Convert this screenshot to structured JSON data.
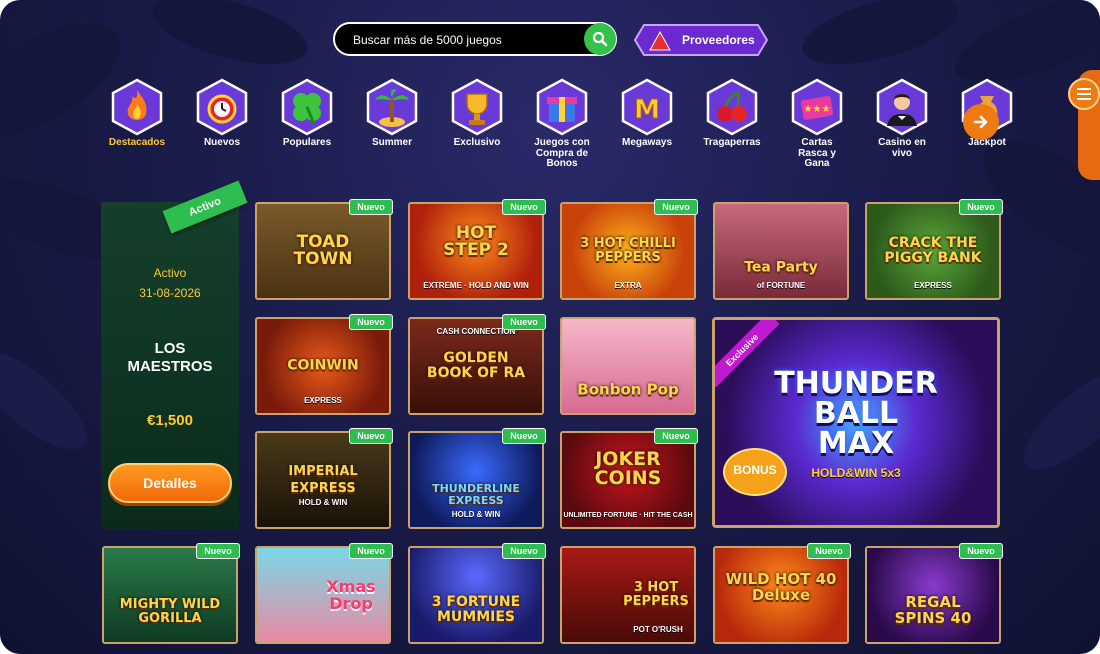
{
  "search": {
    "placeholder": "Buscar más de 5000 juegos",
    "icon": "search-icon"
  },
  "providers_label": "Proveedores",
  "categories": [
    {
      "label": "Destacados",
      "icon": "fire-icon",
      "active": true
    },
    {
      "label": "Nuevos",
      "icon": "alarm-clock-icon"
    },
    {
      "label": "Populares",
      "icon": "clover-icon"
    },
    {
      "label": "Summer",
      "icon": "palm-tree-icon"
    },
    {
      "label": "Exclusivo",
      "icon": "trophy-icon"
    },
    {
      "label": "Juegos con\nCompra de\nBonos",
      "icon": "gift-icon"
    },
    {
      "label": "Megaways",
      "icon": "m-letter-icon"
    },
    {
      "label": "Tragaperras",
      "icon": "cherries-icon"
    },
    {
      "label": "Cartas\nRasca y\nGana",
      "icon": "scratch-card-icon"
    },
    {
      "label": "Casino en\nvivo",
      "icon": "dealer-icon"
    },
    {
      "label": "Jackpot",
      "icon": "money-bag-icon"
    }
  ],
  "promo": {
    "ribbon": "Activo",
    "status": "Activo",
    "date": "31-08-2026",
    "title": "LOS\nMAESTROS",
    "amount": "€1,500",
    "button": "Detalles"
  },
  "badge_new": "Nuevo",
  "games": [
    {
      "name": "TOAD\nTOWN",
      "sub": "",
      "color": "#6b4a22"
    },
    {
      "name": "HOT\nSTEP 2",
      "sub": "EXTREME · HOLD AND WIN",
      "color": "#b0200c"
    },
    {
      "name": "3 HOT CHILLI\nPEPPERS",
      "sub": "EXTRA",
      "color": "#c9420a"
    },
    {
      "name": "Tea Party",
      "sub": "of FORTUNE",
      "color": "#8a3a4a"
    },
    {
      "name": "CRACK THE\nPIGGY BANK",
      "sub": "EXPRESS",
      "color": "#2d6a2a"
    },
    {
      "name": "COINWIN",
      "sub": "EXPRESS",
      "color": "#9a2a10"
    },
    {
      "name": "GOLDEN\nBOOK OF RA",
      "sub": "CASH CONNECTION",
      "color": "#5a1a14"
    },
    {
      "name": "Bonbon Pop",
      "sub": "",
      "color": "#d88aa2"
    },
    {
      "name": "THUNDER\nBALL\nMAX",
      "sub": "HOLD&WIN 5x3",
      "color": "#3b1a7a"
    },
    {
      "name": "IMPERIAL EXPRESS",
      "sub": "HOLD & WIN",
      "color": "#3a2a14"
    },
    {
      "name": "THUNDERLINE\nEXPRESS",
      "sub": "HOLD & WIN",
      "color": "#1a2a7a"
    },
    {
      "name": "JOKER\nCOINS",
      "sub": "UNLIMITED FORTUNE · HIT THE CASH",
      "color": "#7a0a10"
    },
    {
      "name": "MIGHTY WILD\nGORILLA",
      "sub": "",
      "color": "#1f5a3a"
    },
    {
      "name": "Xmas\nDrop",
      "sub": "",
      "color": "#c8484a"
    },
    {
      "name": "3 FORTUNE\nMUMMIES",
      "sub": "",
      "color": "#2a2a8a"
    },
    {
      "name": "3 HOT\nPEPPERS",
      "sub": "POT O'RUSH",
      "color": "#8a140e"
    },
    {
      "name": "WILD HOT 40\nDeluxe",
      "sub": "",
      "color": "#d0400a"
    },
    {
      "name": "REGAL\nSPINS 40",
      "sub": "",
      "color": "#4a1a6a"
    }
  ]
}
